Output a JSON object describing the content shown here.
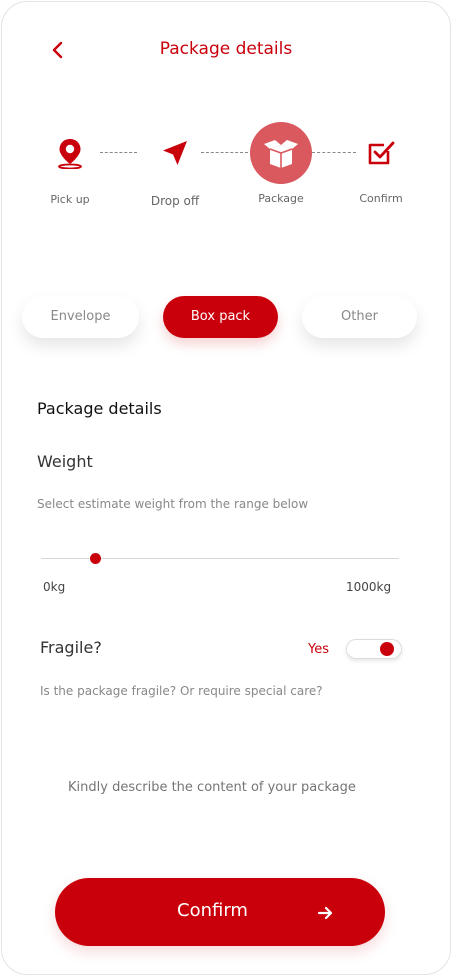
{
  "header": {
    "title": "Package details",
    "back_icon": "chevron-left-icon"
  },
  "colors": {
    "accent": "#c9000b",
    "accent_soft": "#d9595e"
  },
  "steps": [
    {
      "label": "Pick up",
      "icon": "location-pin-icon",
      "state": "done"
    },
    {
      "label": "Drop off",
      "icon": "navigation-arrow-icon",
      "state": "done"
    },
    {
      "label": "Package",
      "icon": "open-box-icon",
      "state": "active"
    },
    {
      "label": "Confirm",
      "icon": "checkbox-icon",
      "state": "pending"
    }
  ],
  "package_types": [
    {
      "label": "Envelope",
      "selected": false
    },
    {
      "label": "Box pack",
      "selected": true
    },
    {
      "label": "Other",
      "selected": false
    }
  ],
  "details": {
    "section_title": "Package details",
    "weight": {
      "label": "Weight",
      "description": "Select estimate weight from the range below",
      "min_label": "0kg",
      "max_label": "1000kg",
      "value_fraction": 0.15
    },
    "fragile": {
      "label": "Fragile?",
      "value_label": "Yes",
      "enabled": true,
      "description": "Is the package fragile? Or require special care?"
    },
    "content_placeholder": "Kindly describe the content of your package"
  },
  "confirm": {
    "label": "Confirm",
    "icon": "arrow-right-icon"
  }
}
